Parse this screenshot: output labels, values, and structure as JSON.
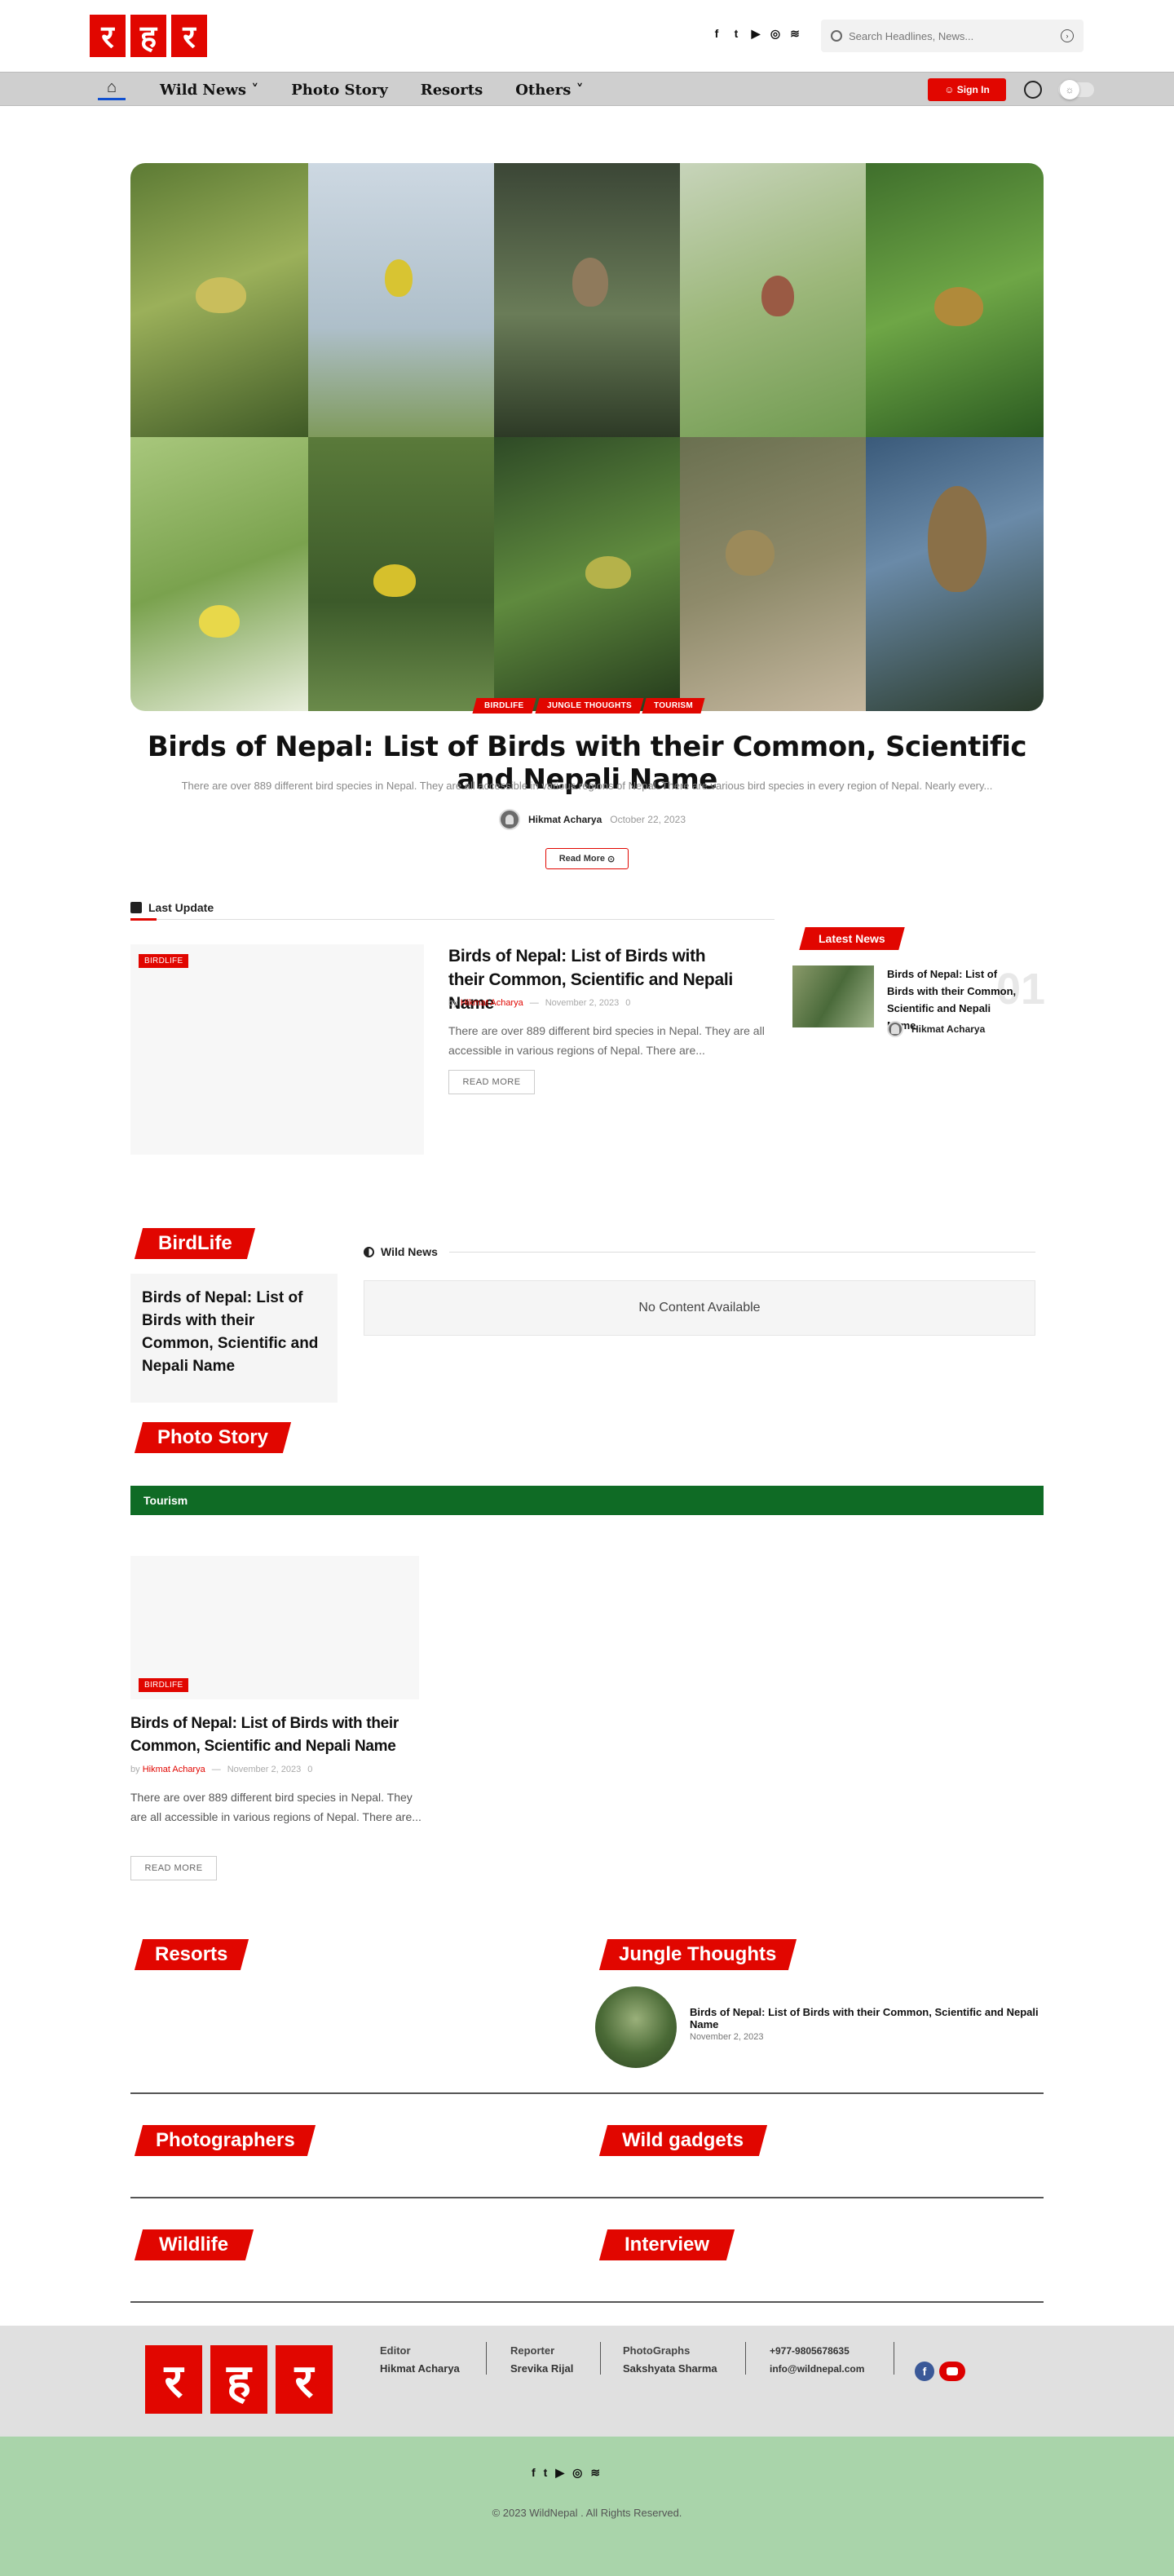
{
  "brand": {
    "logo_letters": [
      "र",
      "ह",
      "र"
    ],
    "accent": "#e10600",
    "green": "#0f6b25"
  },
  "header": {
    "social_icons": [
      "facebook-icon",
      "twitter-icon",
      "youtube-icon",
      "instagram-icon",
      "rss-icon"
    ],
    "social_glyphs": [
      "f",
      "t",
      "▶",
      "◎",
      "≋"
    ],
    "search": {
      "placeholder": "Search Headlines, News..."
    }
  },
  "nav": {
    "home_glyph": "⌂",
    "items": [
      {
        "label": "Wild News",
        "dropdown": true
      },
      {
        "label": "Photo Story",
        "dropdown": false
      },
      {
        "label": "Resorts",
        "dropdown": false
      },
      {
        "label": "Others",
        "dropdown": true
      }
    ],
    "signin_label": "Sign In"
  },
  "hero": {
    "categories": [
      "BIRDLIFE",
      "JUNGLE THOUGHTS",
      "TOURISM"
    ],
    "title": "Birds of Nepal: List of Birds with their Common, Scientific and Nepali Name",
    "excerpt": "There are over 889 different bird species in Nepal. They are all accessible in various regions of Nepal. There are various bird species in every region of Nepal. Nearly every...",
    "author": "Hikmat Acharya",
    "date": "October 22, 2023",
    "read_more": "Read More"
  },
  "last_update": {
    "heading": "Last Update",
    "category": "BIRDLIFE",
    "title": "Birds of Nepal: List of Birds with their Common, Scientific and Nepali Name",
    "by": "by",
    "author": "Hikmat Acharya",
    "date": "November 2, 2023",
    "comments": "0",
    "excerpt": "There are over 889 different bird species in Nepal. They are all accessible in various regions of Nepal. There are...",
    "read_more": "READ MORE"
  },
  "latest_news": {
    "heading": "Latest News",
    "title": "Birds of Nepal: List of Birds with their Common, Scientific and Nepali Name",
    "number": "01",
    "author": "Hikmat Acharya"
  },
  "birdlife": {
    "heading": "BirdLife",
    "card_title": "Birds of Nepal: List of Birds with their Common, Scientific and Nepali Name"
  },
  "wild_news": {
    "heading": "Wild News",
    "empty": "No Content Available"
  },
  "photo_story": {
    "heading": "Photo Story"
  },
  "tourism": {
    "heading": "Tourism",
    "category": "BIRDLIFE",
    "title": "Birds of Nepal: List of Birds with their Common, Scientific and Nepali Name",
    "by": "by",
    "author": "Hikmat Acharya",
    "date": "November 2, 2023",
    "comments": "0",
    "excerpt": "There are over 889 different bird species in Nepal. They are all accessible in various regions of Nepal. There are...",
    "read_more": "READ MORE"
  },
  "sections": {
    "resorts": "Resorts",
    "jungle_thoughts": "Jungle Thoughts",
    "photographers": "Photographers",
    "wild_gadgets": "Wild gadgets",
    "wildlife": "Wildlife",
    "interview": "Interview"
  },
  "jungle_post": {
    "title": "Birds of Nepal: List of Birds with their Common, Scientific and Nepali Name",
    "date": "November 2, 2023"
  },
  "footer": {
    "editor_label": "Editor",
    "editor": "Hikmat Acharya",
    "reporter_label": "Reporter",
    "reporter": "Srevika Rijal",
    "photo_label": "PhotoGraphs",
    "photographer": "Sakshyata Sharma",
    "phone": "+977-9805678635",
    "email": "info@wildnepal.com",
    "copyright": "© 2023 WildNepal . All Rights Reserved."
  }
}
